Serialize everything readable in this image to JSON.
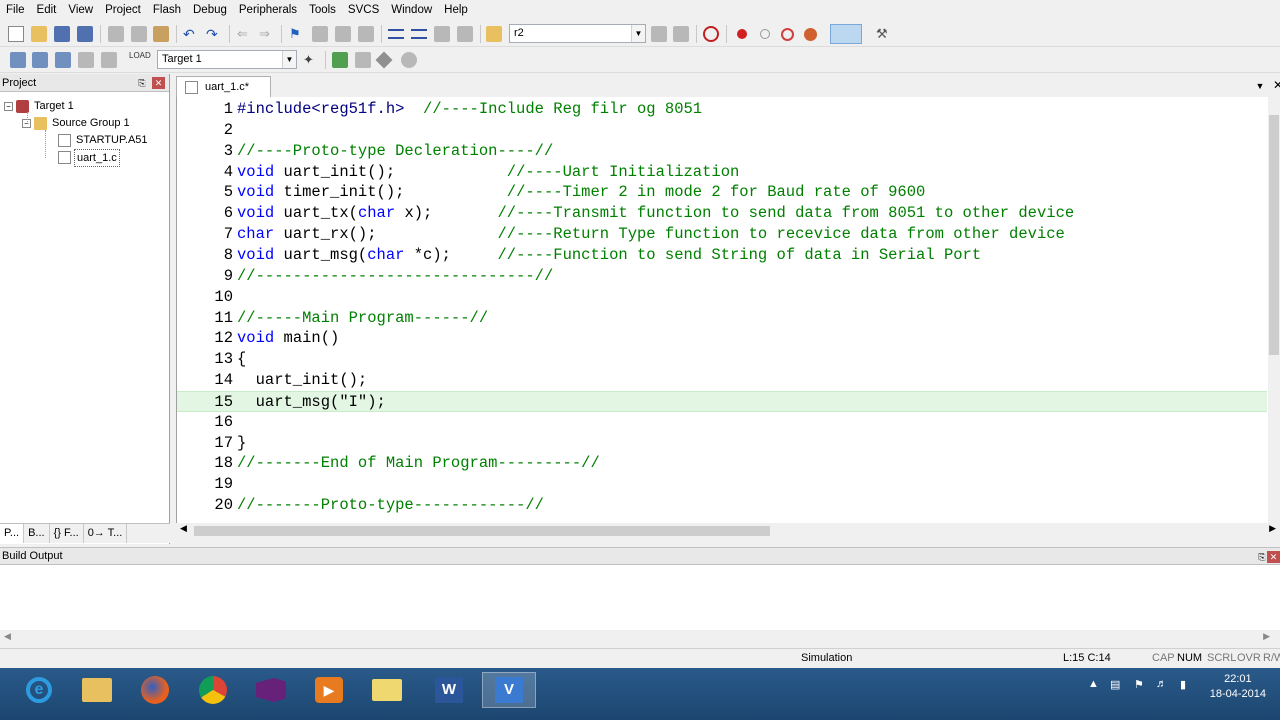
{
  "menu": [
    "File",
    "Edit",
    "View",
    "Project",
    "Flash",
    "Debug",
    "Peripherals",
    "Tools",
    "SVCS",
    "Window",
    "Help"
  ],
  "toolbar": {
    "find_value": "r2",
    "target_value": "Target 1"
  },
  "project_panel": {
    "title": "Project",
    "tree": {
      "target": "Target 1",
      "group": "Source Group 1",
      "files": [
        "STARTUP.A51",
        "uart_1.c"
      ]
    },
    "tabs": [
      "P...",
      "B...",
      "{} F...",
      "0→ T..."
    ]
  },
  "editor": {
    "tab_label": "uart_1.c*",
    "lines": [
      {
        "n": "1",
        "segs": [
          [
            "pp",
            "#include<reg51f.h>"
          ],
          [
            "",
            "  "
          ],
          [
            "cm",
            "//----Include Reg filr og 8051"
          ]
        ]
      },
      {
        "n": "2",
        "segs": []
      },
      {
        "n": "3",
        "segs": [
          [
            "cm",
            "//----Proto-type Decleration----//"
          ]
        ]
      },
      {
        "n": "4",
        "segs": [
          [
            "kw",
            "void"
          ],
          [
            "",
            " uart_init();            "
          ],
          [
            "cm",
            "//----Uart Initialization"
          ]
        ]
      },
      {
        "n": "5",
        "segs": [
          [
            "kw",
            "void"
          ],
          [
            "",
            " timer_init();           "
          ],
          [
            "cm",
            "//----Timer 2 in mode 2 for Baud rate of 9600"
          ]
        ]
      },
      {
        "n": "6",
        "segs": [
          [
            "kw",
            "void"
          ],
          [
            "",
            " uart_tx("
          ],
          [
            "kw",
            "char"
          ],
          [
            "",
            " x);       "
          ],
          [
            "cm",
            "//----Transmit function to send data from 8051 to other device"
          ]
        ]
      },
      {
        "n": "7",
        "segs": [
          [
            "kw",
            "char"
          ],
          [
            "",
            " uart_rx();             "
          ],
          [
            "cm",
            "//----Return Type function to recevice data from other device"
          ]
        ]
      },
      {
        "n": "8",
        "segs": [
          [
            "kw",
            "void"
          ],
          [
            "",
            " uart_msg("
          ],
          [
            "kw",
            "char"
          ],
          [
            "",
            " *c);     "
          ],
          [
            "cm",
            "//----Function to send String of data in Serial Port"
          ]
        ]
      },
      {
        "n": "9",
        "segs": [
          [
            "cm",
            "//------------------------------//"
          ]
        ]
      },
      {
        "n": "10",
        "segs": []
      },
      {
        "n": "11",
        "segs": [
          [
            "cm",
            "//-----Main Program------//"
          ]
        ]
      },
      {
        "n": "12",
        "segs": [
          [
            "kw",
            "void"
          ],
          [
            "",
            " main()"
          ]
        ]
      },
      {
        "n": "13",
        "segs": [
          [
            "",
            "{"
          ]
        ]
      },
      {
        "n": "14",
        "segs": [
          [
            "",
            "  uart_init();"
          ]
        ]
      },
      {
        "n": "15",
        "segs": [
          [
            "",
            "  uart_msg(\"I\");"
          ]
        ],
        "highlight": true
      },
      {
        "n": "16",
        "segs": []
      },
      {
        "n": "17",
        "segs": [
          [
            "",
            "}"
          ]
        ]
      },
      {
        "n": "18",
        "segs": [
          [
            "cm",
            "//-------End of Main Program---------//"
          ]
        ]
      },
      {
        "n": "19",
        "segs": []
      },
      {
        "n": "20",
        "segs": [
          [
            "cm",
            "//-------Proto-type------------//"
          ]
        ]
      }
    ]
  },
  "build_output": {
    "title": "Build Output"
  },
  "status": {
    "mode": "Simulation",
    "position": "L:15 C:14",
    "caps": "CAP",
    "num": "NUM",
    "scrl": "SCRL",
    "ovr": "OVR",
    "rw": "R/W"
  },
  "taskbar": {
    "time": "22:01",
    "date": "18-04-2014",
    "apps": [
      "ie",
      "explorer",
      "firefox",
      "chrome",
      "visualstudio",
      "media",
      "folder",
      "word",
      "keil"
    ]
  },
  "colors": {
    "keyword": "#0000ff",
    "comment": "#008000",
    "preproc": "#000080",
    "highlight": "#e3f6e3"
  }
}
